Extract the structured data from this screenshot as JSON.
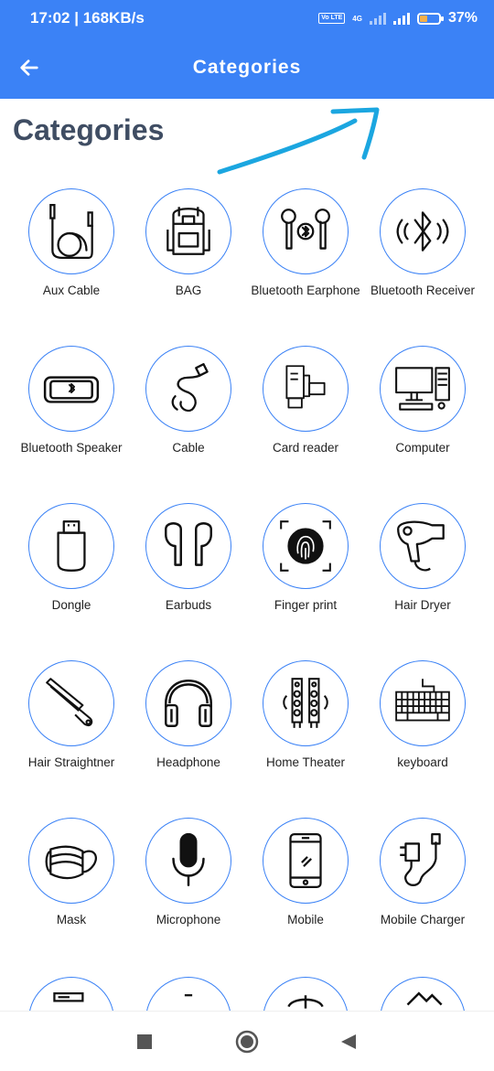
{
  "status_bar": {
    "time": "17:02",
    "speed": "| 168KB/s",
    "volte": "Vo LTE",
    "network": "4G",
    "battery": "37%"
  },
  "app_bar": {
    "title": "Categories",
    "back_icon": "arrow-left-icon"
  },
  "page": {
    "heading": "Categories"
  },
  "categories": [
    {
      "label": "Aux Cable",
      "icon": "aux-cable-icon"
    },
    {
      "label": "BAG",
      "icon": "backpack-icon"
    },
    {
      "label": "Bluetooth Earphone",
      "icon": "bluetooth-earphone-icon"
    },
    {
      "label": "Bluetooth Receiver",
      "icon": "bluetooth-receiver-icon"
    },
    {
      "label": "Bluetooth Speaker",
      "icon": "bluetooth-speaker-icon"
    },
    {
      "label": "Cable",
      "icon": "cable-icon"
    },
    {
      "label": "Card reader",
      "icon": "card-reader-icon"
    },
    {
      "label": "Computer",
      "icon": "computer-icon"
    },
    {
      "label": "Dongle",
      "icon": "dongle-icon"
    },
    {
      "label": "Earbuds",
      "icon": "earbuds-icon"
    },
    {
      "label": "Finger print",
      "icon": "fingerprint-icon"
    },
    {
      "label": "Hair Dryer",
      "icon": "hair-dryer-icon"
    },
    {
      "label": "Hair Straightner",
      "icon": "hair-straightener-icon"
    },
    {
      "label": "Headphone",
      "icon": "headphone-icon"
    },
    {
      "label": "Home Theater",
      "icon": "home-theater-icon"
    },
    {
      "label": "keyboard",
      "icon": "keyboard-icon"
    },
    {
      "label": "Mask",
      "icon": "mask-icon"
    },
    {
      "label": "Microphone",
      "icon": "microphone-icon"
    },
    {
      "label": "Mobile",
      "icon": "mobile-icon"
    },
    {
      "label": "Mobile Charger",
      "icon": "mobile-charger-icon"
    }
  ],
  "colors": {
    "primary": "#3b82f6",
    "heading": "#3f4d63",
    "annotation": "#1ba6e0"
  },
  "nav_bar": {
    "icons": [
      "square-icon",
      "circle-icon",
      "back-triangle-icon"
    ]
  }
}
